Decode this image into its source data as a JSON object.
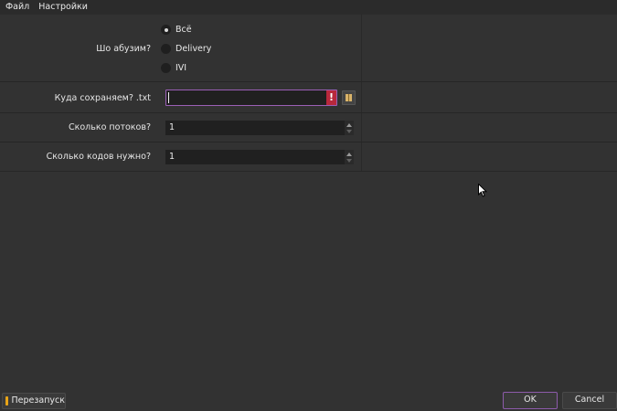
{
  "menu": {
    "file": "Файл",
    "settings": "Настройки"
  },
  "form": {
    "abuse_label": "Шо абузим?",
    "abuse_options": [
      {
        "label": "Всё",
        "checked": true
      },
      {
        "label": "Delivery",
        "checked": false
      },
      {
        "label": "IVI",
        "checked": false
      }
    ],
    "save_label": "Куда сохраняем? .txt",
    "save_value": "",
    "threads_label": "Сколько потоков?",
    "threads_value": "1",
    "codes_label": "Сколько кодов нужно?",
    "codes_value": "1"
  },
  "icons": {
    "warning": "exclamation-icon",
    "folder": "folder-icon",
    "restart": "restart-icon",
    "cursor": "mouse-cursor-icon"
  },
  "buttons": {
    "restart": "Перезапуск",
    "ok": "OK",
    "cancel": "Cancel"
  },
  "colors": {
    "background": "#323232",
    "accent": "#9a5fb6",
    "error": "#b8283c",
    "restart_icon": "#e8a417"
  }
}
